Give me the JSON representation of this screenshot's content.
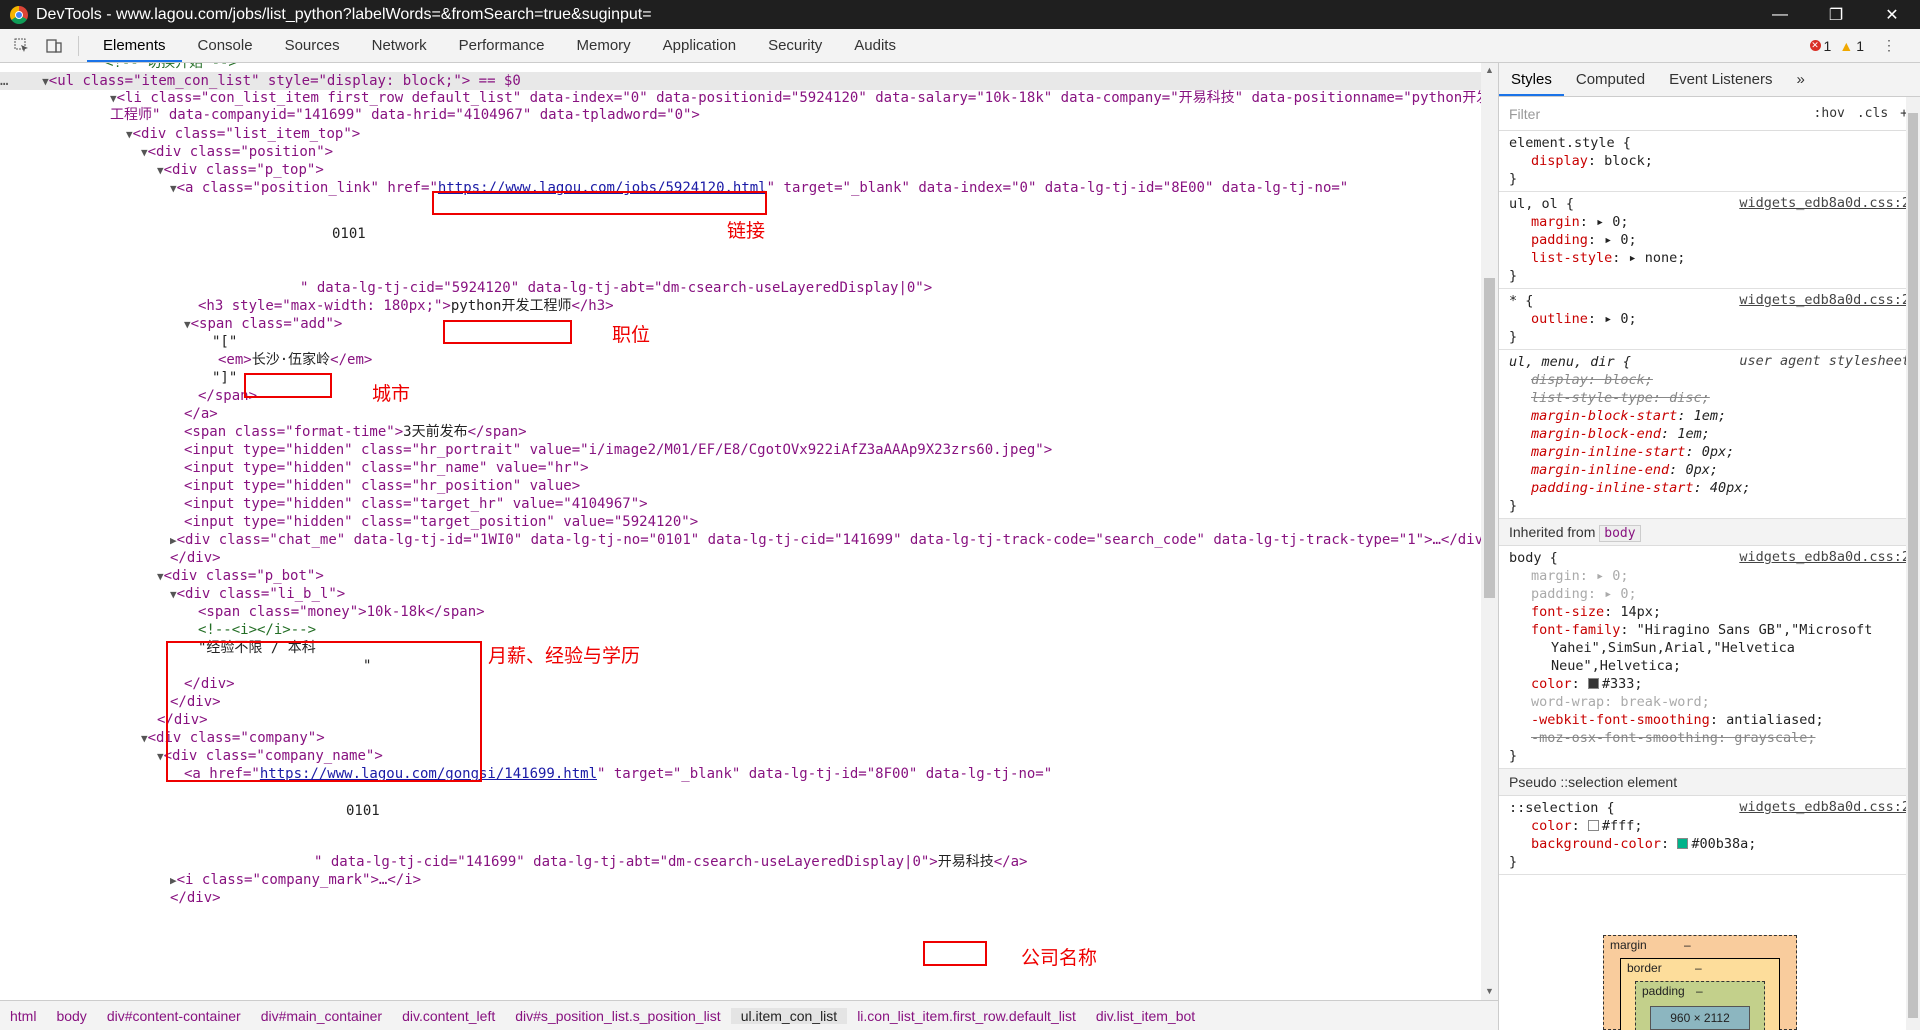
{
  "window": {
    "title": "DevTools - www.lagou.com/jobs/list_python?labelWords=&fromSearch=true&suginput=",
    "min": "—",
    "max": "❐",
    "close": "✕"
  },
  "toolbar": {
    "tabs": [
      "Elements",
      "Console",
      "Sources",
      "Network",
      "Performance",
      "Memory",
      "Application",
      "Security",
      "Audits"
    ],
    "error_count": "1",
    "warning_count": "1"
  },
  "dom": {
    "comment_top": "<!-- 切换开始 -->",
    "ul_open": "<ul class=\"item_con_list\" style=\"display: block;\"> == $0",
    "li_open_1": "<li class=\"con_list_item first_row default_list\" data-index=\"0\" data-positionid=\"5924120\" data-salary=\"10k-18k\" data-company=\"开易科技\" data-positionname=\"python开发",
    "li_open_2": "工程师\" data-companyid=\"141699\" data-hrid=\"4104967\" data-tpladword=\"0\">",
    "div_list_item_top": "<div class=\"list_item_top\">",
    "div_position": "<div class=\"position\">",
    "div_p_top": "<div class=\"p_top\">",
    "a_pos_pre": "<a class=\"position_link\" href=\"",
    "a_pos_href": "https://www.lagou.com/jobs/5924120.html",
    "a_pos_post": "\" target=\"_blank\" data-index=\"0\" data-lg-tj-id=\"8E00\" data-lg-tj-no=\"",
    "num_0101_a": "0101",
    "a_pos_tail": "\" data-lg-tj-cid=\"5924120\" data-lg-tj-abt=\"dm-csearch-useLayeredDisplay|0\">",
    "h3_pre": "<h3 style=\"max-width: 180px;\">",
    "h3_text": "python开发工程师",
    "h3_post": "</h3>",
    "span_add": "<span class=\"add\">",
    "bracket_open": "\"[\"",
    "em_pre": "<em>",
    "em_text": "长沙·伍家岭",
    "em_post": "</em>",
    "bracket_close": "\"]\"",
    "span_close": "</span>",
    "a_close": "</a>",
    "span_time_pre": "<span class=\"format-time\">",
    "span_time_text": "3天前发布",
    "span_time_post": "</span>",
    "input1": "<input type=\"hidden\" class=\"hr_portrait\" value=\"i/image2/M01/EF/E8/CgotOVx922iAfZ3aAAAp9X23zrs60.jpeg\">",
    "input2": "<input type=\"hidden\" class=\"hr_name\" value=\"hr\">",
    "input3": "<input type=\"hidden\" class=\"hr_position\" value>",
    "input4": "<input type=\"hidden\" class=\"target_hr\" value=\"4104967\">",
    "input5": "<input type=\"hidden\" class=\"target_position\" value=\"5924120\">",
    "div_chat_me": "<div class=\"chat_me\" data-lg-tj-id=\"1WI0\" data-lg-tj-no=\"0101\" data-lg-tj-cid=\"141699\" data-lg-tj-track-code=\"search_code\" data-lg-tj-track-type=\"1\">…</div>",
    "div_close_a": "</div>",
    "div_p_bot": "<div class=\"p_bot\">",
    "div_li_b_l": "<div class=\"li_b_l\">",
    "span_money": "<span class=\"money\">10k-18k</span>",
    "comment_i": "<!--<i></i>-->",
    "exp_text": "\"经验不限 / 本科",
    "quote_end": "\"",
    "div_close_b": "</div>",
    "div_close_c": "</div>",
    "div_close_d": "</div>",
    "div_company": "<div class=\"company\">",
    "div_company_name": "<div class=\"company_name\">",
    "a_comp_pre": "<a href=\"",
    "a_comp_href": "https://www.lagou.com/gongsi/141699.html",
    "a_comp_post": "\" target=\"_blank\" data-lg-tj-id=\"8F00\" data-lg-tj-no=\"",
    "num_0101_b": "0101",
    "a_comp_tail": "\" data-lg-tj-cid=\"141699\" data-lg-tj-abt=\"dm-csearch-useLayeredDisplay|0\">",
    "a_comp_text": "开易科技",
    "a_comp_close": "</a>",
    "i_company_mark": "<i class=\"company_mark\">…</i>",
    "div_close_e": "</div>"
  },
  "annotations": {
    "link": "链接",
    "position": "职位",
    "city": "城市",
    "salary_exp_edu": "月薪、经验与学历",
    "company_name": "公司名称"
  },
  "breadcrumb": [
    "html",
    "body",
    "div#content-container",
    "div#main_container",
    "div.content_left",
    "div#s_position_list.s_position_list",
    "ul.item_con_list",
    "li.con_list_item.first_row.default_list",
    "div.list_item_bot"
  ],
  "sidebar": {
    "tabs": [
      "Styles",
      "Computed",
      "Event Listeners"
    ],
    "filter_placeholder": "Filter",
    "hov": ":hov",
    "cls": ".cls",
    "plus": "+",
    "rules": {
      "element_style": {
        "selector": "element.style {",
        "display": "display",
        "display_val": "block;"
      },
      "ul_ol": {
        "selector": "ul, ol {",
        "source": "widgets_edb8a0d.css:2",
        "margin": "margin",
        "margin_val": "0;",
        "padding": "padding",
        "padding_val": "0;",
        "list_style": "list-style",
        "list_style_val": "none;"
      },
      "star": {
        "selector": "* {",
        "source": "widgets_edb8a0d.css:2",
        "outline": "outline",
        "outline_val": "0;"
      },
      "ua": {
        "selector": "ul, menu, dir {",
        "source": "user agent stylesheet",
        "l1": "display: block;",
        "l2": "list-style-type: disc;",
        "l3n": "margin-block-start",
        "l3v": "1em;",
        "l4n": "margin-block-end",
        "l4v": "1em;",
        "l5n": "margin-inline-start",
        "l5v": "0px;",
        "l6n": "margin-inline-end",
        "l6v": "0px;",
        "l7n": "padding-inline-start",
        "l7v": "40px;"
      },
      "inherited_label": "Inherited from",
      "inherited_tag": "body",
      "body": {
        "selector": "body {",
        "source": "widgets_edb8a0d.css:2",
        "l1": "margin: ▸ 0;",
        "l2": "padding: ▸ 0;",
        "l3n": "font-size",
        "l3v": "14px;",
        "l4n": "font-family",
        "l4v": "\"Hiragino Sans GB\",\"Microsoft",
        "l4v2": "Yahei\",SimSun,Arial,\"Helvetica",
        "l4v3": "Neue\",Helvetica;",
        "l5n": "color",
        "l5v": "#333;",
        "l5c": "#333333",
        "l6": "word-wrap: break-word;",
        "l7n": "-webkit-font-smoothing",
        "l7v": "antialiased;",
        "l8": "-moz-osx-font-smoothing: grayscale;"
      },
      "pseudo_label": "Pseudo ::selection element",
      "selection": {
        "selector": "::selection {",
        "source": "widgets_edb8a0d.css:2",
        "l1n": "color",
        "l1v": "#fff;",
        "l1c": "#ffffff",
        "l2n": "background-color",
        "l2v": "#00b38a;",
        "l2c": "#00b38a"
      }
    },
    "box_model": {
      "margin": "margin",
      "border": "border",
      "padding": "padding",
      "dash": "–",
      "content": "960 × 2112"
    }
  }
}
